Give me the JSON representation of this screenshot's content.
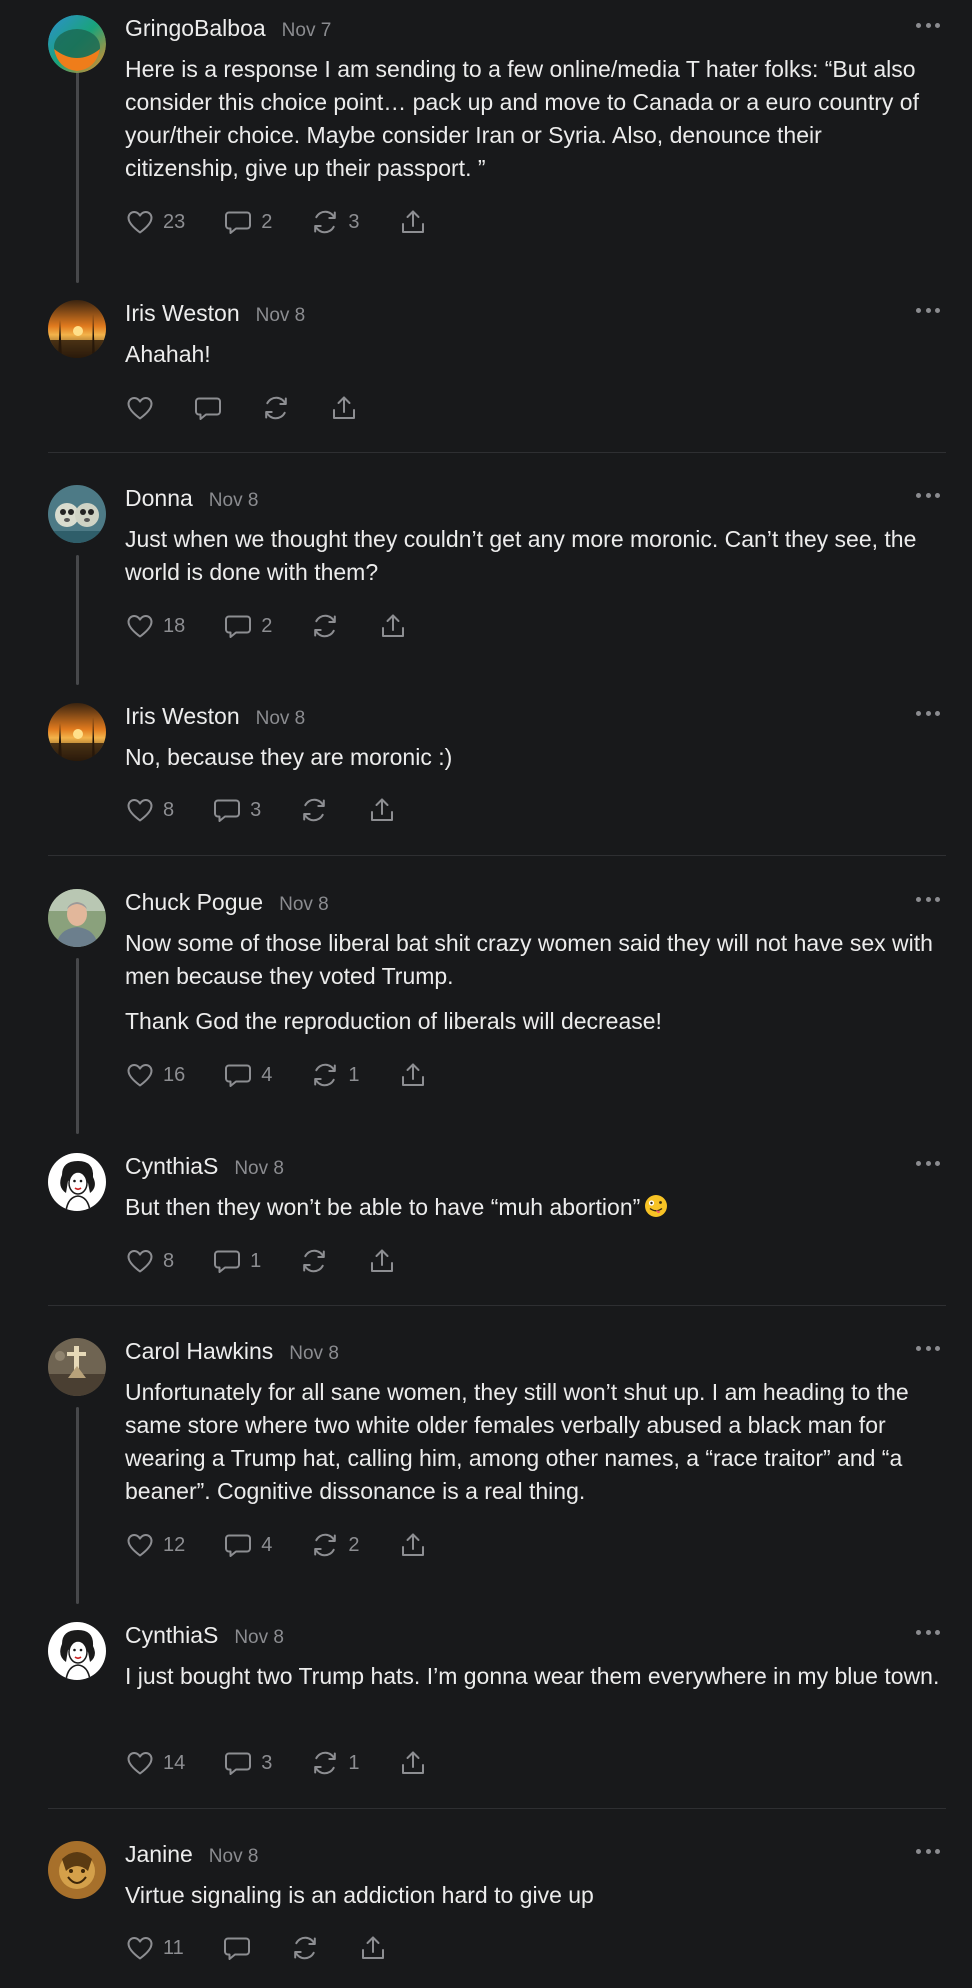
{
  "posts": [
    {
      "author": "GringoBalboa",
      "date": "Nov 7",
      "avatar": "avatar-gringobalboa",
      "text": [
        "Here is a response I am sending to a few online/media T hater folks:   “But also consider this choice point… pack up and move to Canada or a euro country of your/their choice. Maybe consider Iran or Syria. Also, denounce their citizenship, give up their passport. ”"
      ],
      "likes": "23",
      "replies": "2",
      "reposts": "3"
    },
    {
      "author": "Iris Weston",
      "date": "Nov 8",
      "avatar": "avatar-iris-weston",
      "text": [
        "Ahahah!"
      ],
      "likes": "",
      "replies": "",
      "reposts": ""
    },
    {
      "author": "Donna",
      "date": "Nov 8",
      "avatar": "avatar-donna",
      "text": [
        "Just when we thought they couldn’t get any more moronic. Can’t they see, the world is done with them?"
      ],
      "likes": "18",
      "replies": "2",
      "reposts": ""
    },
    {
      "author": "Iris Weston",
      "date": "Nov 8",
      "avatar": "avatar-iris-weston",
      "text": [
        "No, because they are moronic :)"
      ],
      "likes": "8",
      "replies": "3",
      "reposts": ""
    },
    {
      "author": "Chuck Pogue",
      "date": "Nov 8",
      "avatar": "avatar-chuck-pogue",
      "text": [
        "Now some of those liberal bat shit crazy women said they will not have sex with men because they voted Trump.",
        "Thank God the reproduction of liberals will decrease!"
      ],
      "likes": "16",
      "replies": "4",
      "reposts": "1"
    },
    {
      "author": "CynthiaS",
      "date": "Nov 8",
      "avatar": "avatar-cynthias",
      "text": [
        "But then they won’t be able to have “muh abortion”"
      ],
      "emoji": "zany-face-emoji",
      "likes": "8",
      "replies": "1",
      "reposts": ""
    },
    {
      "author": "Carol Hawkins",
      "date": "Nov 8",
      "avatar": "avatar-carol-hawkins",
      "text": [
        "Unfortunately for all sane women, they still won’t shut up. I am heading to the same store where two white older females verbally abused a black man for wearing a Trump hat, calling him, among other names, a “race traitor” and “a beaner”. Cognitive dissonance is a real thing."
      ],
      "likes": "12",
      "replies": "4",
      "reposts": "2"
    },
    {
      "author": "CynthiaS",
      "date": "Nov 8",
      "avatar": "avatar-cynthias",
      "text": [
        "I just bought two Trump hats. I’m gonna wear them everywhere in my blue town."
      ],
      "likes": "14",
      "replies": "3",
      "reposts": "1"
    },
    {
      "author": "Janine",
      "date": "Nov 8",
      "avatar": "avatar-janine",
      "text": [
        "Virtue signaling is an addiction hard to give up"
      ],
      "likes": "11",
      "replies": "",
      "reposts": ""
    }
  ],
  "icons": {
    "like": "heart-icon",
    "reply": "comment-icon",
    "repost": "repost-icon",
    "share": "share-icon",
    "more": "more-dots-icon"
  },
  "colors": {
    "background": "#18191b",
    "text": "#ececec",
    "muted": "#8b8c90",
    "thread_line": "#47484b",
    "divider": "#2e2f32"
  }
}
